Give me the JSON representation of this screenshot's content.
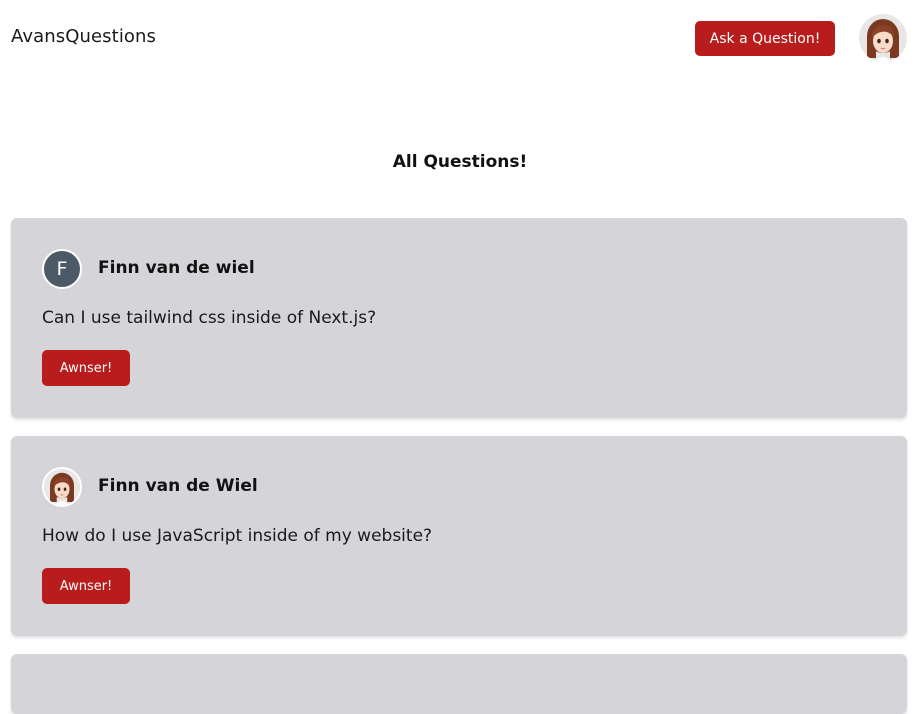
{
  "header": {
    "brand": "AvansQuestions",
    "ask_button_label": "Ask a Question!",
    "user_avatar_icon": "anime-girl-avatar-icon"
  },
  "main": {
    "title": "All Questions!",
    "questions": [
      {
        "author": "Finn van de wiel",
        "avatar_letter": "F",
        "avatar_color": "#4b5a66",
        "text": "Can I use tailwind css inside of Next.js?",
        "answer_label": "Awnser!"
      },
      {
        "author": "Finn van de Wiel",
        "avatar_icon": "anime-girl-avatar-icon",
        "text": "How do I use JavaScript inside of my website?",
        "answer_label": "Awnser!"
      }
    ]
  },
  "colors": {
    "accent": "#b91c1c",
    "card_background": "#d5d4d9",
    "page_background": "#ffffff"
  }
}
